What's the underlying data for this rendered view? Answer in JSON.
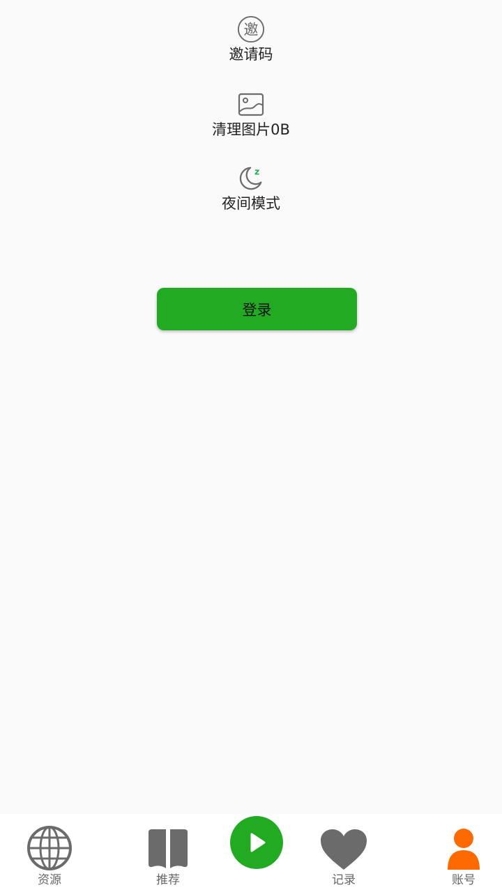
{
  "menu": {
    "invite": {
      "label": "邀请码",
      "icon_glyph": "邀",
      "icon": "invite-icon"
    },
    "clear_images": {
      "label": "清理图片0B",
      "icon": "image-icon"
    },
    "night_mode": {
      "label": "夜间模式",
      "icon": "moon-icon",
      "icon_badge": "z"
    }
  },
  "login": {
    "label": "登录"
  },
  "tabbar": {
    "tabs": [
      {
        "label": "资源",
        "icon": "globe-icon"
      },
      {
        "label": "推荐",
        "icon": "book-icon"
      },
      {
        "label": "记录",
        "icon": "heart-icon"
      },
      {
        "label": "账号",
        "icon": "person-icon"
      }
    ],
    "center": {
      "icon": "play-icon"
    }
  },
  "colors": {
    "accent_green": "#22aa22",
    "active_orange": "#ff6a00",
    "icon_gray": "#6b6b6b",
    "background": "#fafafa"
  }
}
